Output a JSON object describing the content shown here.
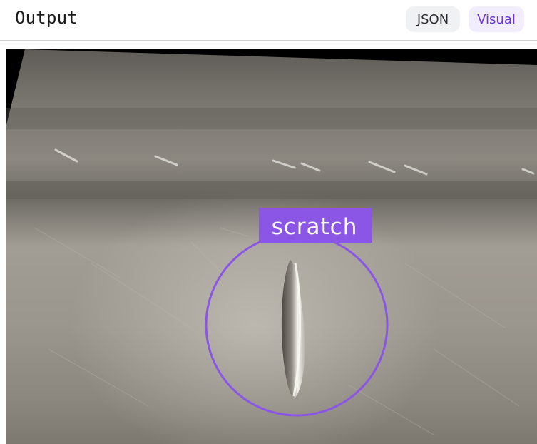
{
  "header": {
    "title": "Output",
    "tabs": [
      {
        "label": "JSON",
        "active": false
      },
      {
        "label": "Visual",
        "active": true
      }
    ]
  },
  "image": {
    "subject": "metal-surface-photo",
    "detections": [
      {
        "label": "scratch",
        "shape": "circle",
        "color": "#8b55e6"
      }
    ]
  },
  "colors": {
    "accent": "#6a35d4",
    "annotation": "#8b55e6",
    "tab_active_bg": "#f1edfd",
    "tab_inactive_bg": "#f0f1f3"
  }
}
